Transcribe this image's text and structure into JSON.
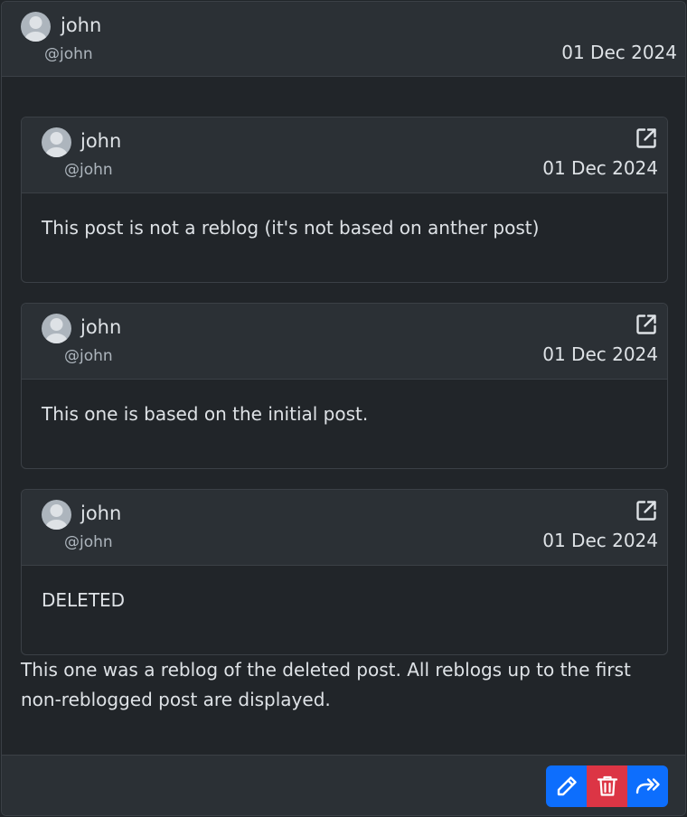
{
  "post": {
    "author": {
      "name": "john",
      "handle": "@john"
    },
    "date": "01 Dec 2024",
    "reblog_chain": [
      {
        "author": {
          "name": "john",
          "handle": "@john"
        },
        "date": "01 Dec 2024",
        "content": "This post is not a reblog (it's not based on anther post)"
      },
      {
        "author": {
          "name": "john",
          "handle": "@john"
        },
        "date": "01 Dec 2024",
        "content": "This one is based on the initial post."
      },
      {
        "author": {
          "name": "john",
          "handle": "@john"
        },
        "date": "01 Dec 2024",
        "content": "DELETED"
      }
    ],
    "content": "This one was a reblog of the deleted post. All reblogs up to the first non-reblogged post are displayed."
  },
  "actions": {
    "edit_icon": "pencil-icon",
    "delete_icon": "trash-icon",
    "reblog_icon": "double-arrow-forward-icon"
  },
  "colors": {
    "primary": "#0d6efd",
    "danger": "#dc3545",
    "background": "#212529",
    "header": "#2b3035"
  }
}
